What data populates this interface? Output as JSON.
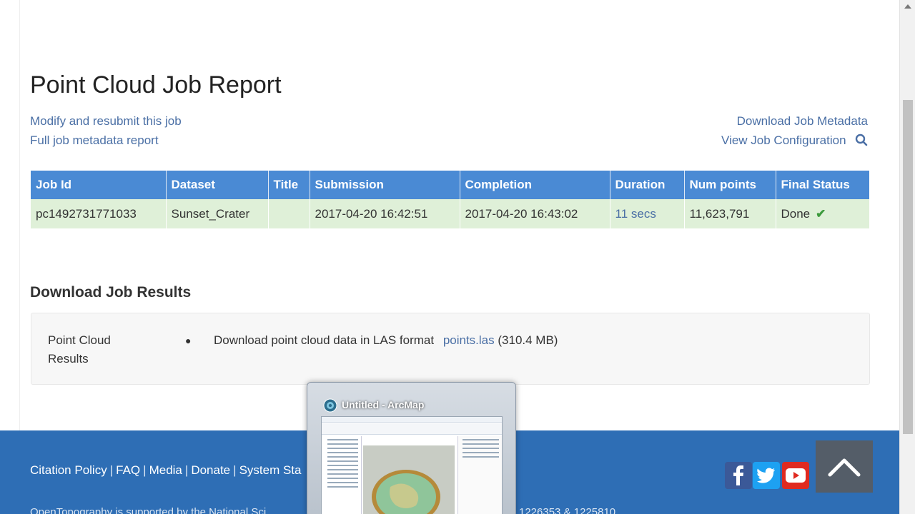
{
  "page": {
    "title": "Point Cloud Job Report",
    "links_left": [
      "Modify and resubmit this job",
      "Full job metadata report"
    ],
    "links_right": [
      "Download Job Metadata",
      "View Job Configuration"
    ]
  },
  "job_table": {
    "headers": [
      "Job Id",
      "Dataset",
      "Title",
      "Submission",
      "Completion",
      "Duration",
      "Num points",
      "Final Status"
    ],
    "row": {
      "job_id": "pc1492731771033",
      "dataset": "Sunset_Crater",
      "title": "",
      "submission": "2017-04-20 16:42:51",
      "completion": "2017-04-20 16:43:02",
      "duration": "11 secs",
      "num_points": "11,623,791",
      "final_status": "Done"
    },
    "status_color": "#dff0d8",
    "header_color": "#4a8ad4"
  },
  "results": {
    "heading": "Download Job Results",
    "label_line1": "Point Cloud",
    "label_line2": "Results",
    "item_text": "Download point cloud data in LAS format",
    "file_link": "points.las",
    "file_size": "(310.4 MB)"
  },
  "footer": {
    "links": [
      "Citation Policy",
      "FAQ",
      "Media",
      "Donate",
      "System Sta"
    ],
    "bottom_left": "OpenTopography is supported by the National Sci",
    "bottom_right": "1226353 & 1225810",
    "bg_color": "#2e6eb5"
  },
  "taskbar_preview": {
    "title": "Untitled - ArcMap"
  }
}
